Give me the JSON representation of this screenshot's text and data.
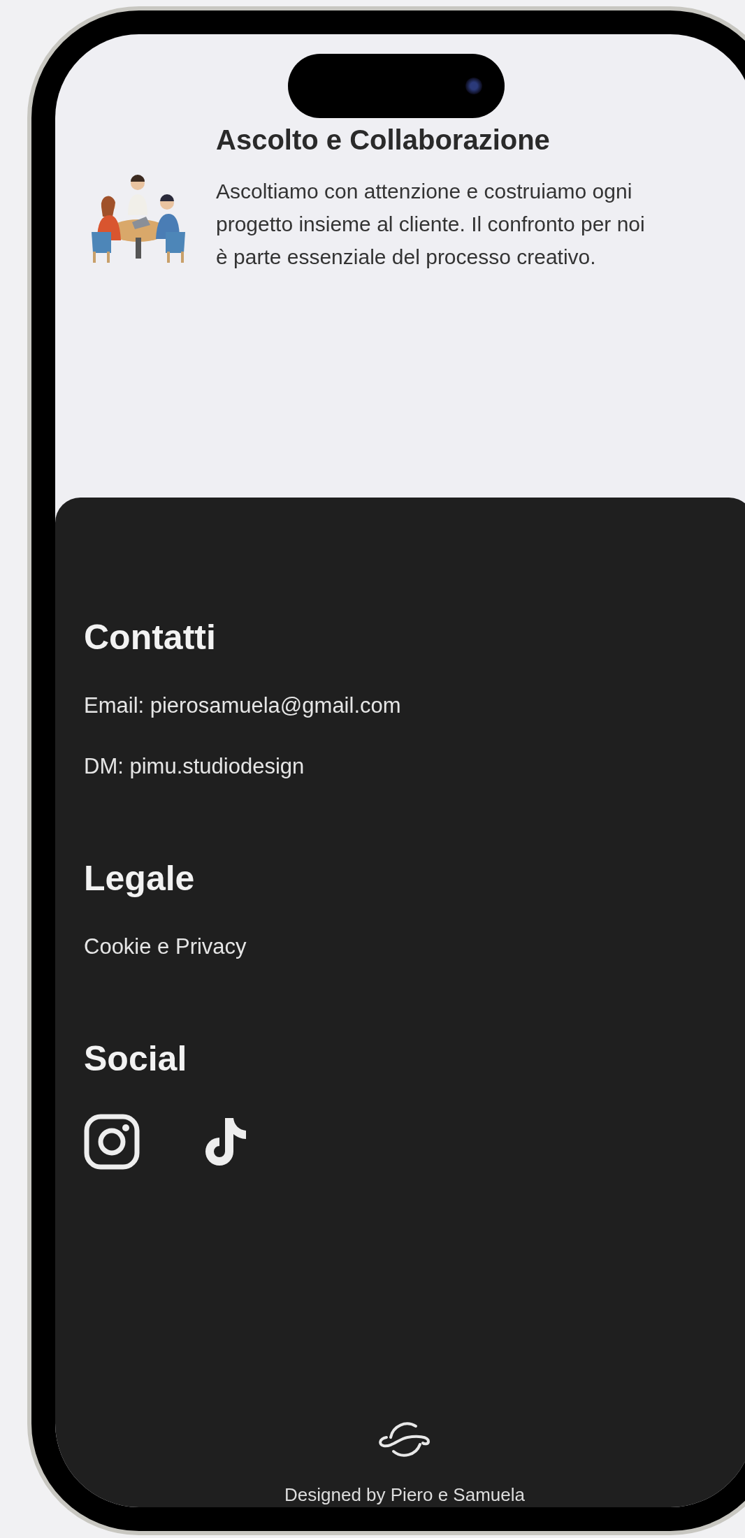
{
  "feature": {
    "title": "Ascolto e Collaborazione",
    "text": "Ascoltiamo con attenzione e costruiamo ogni progetto insieme al cliente. Il confronto per noi è parte essenziale del processo creativo."
  },
  "footer": {
    "sections": [
      {
        "heading": "Contatti",
        "links": [
          "Email: pierosamuela@gmail.com",
          "DM: pimu.studiodesign"
        ]
      },
      {
        "heading": "Legale",
        "links": [
          "Cookie e Privacy"
        ]
      },
      {
        "heading": "Social",
        "icons": [
          {
            "kind": "camera"
          },
          {
            "kind": "note"
          }
        ]
      }
    ],
    "credit": "Designed by Piero e Samuela"
  }
}
